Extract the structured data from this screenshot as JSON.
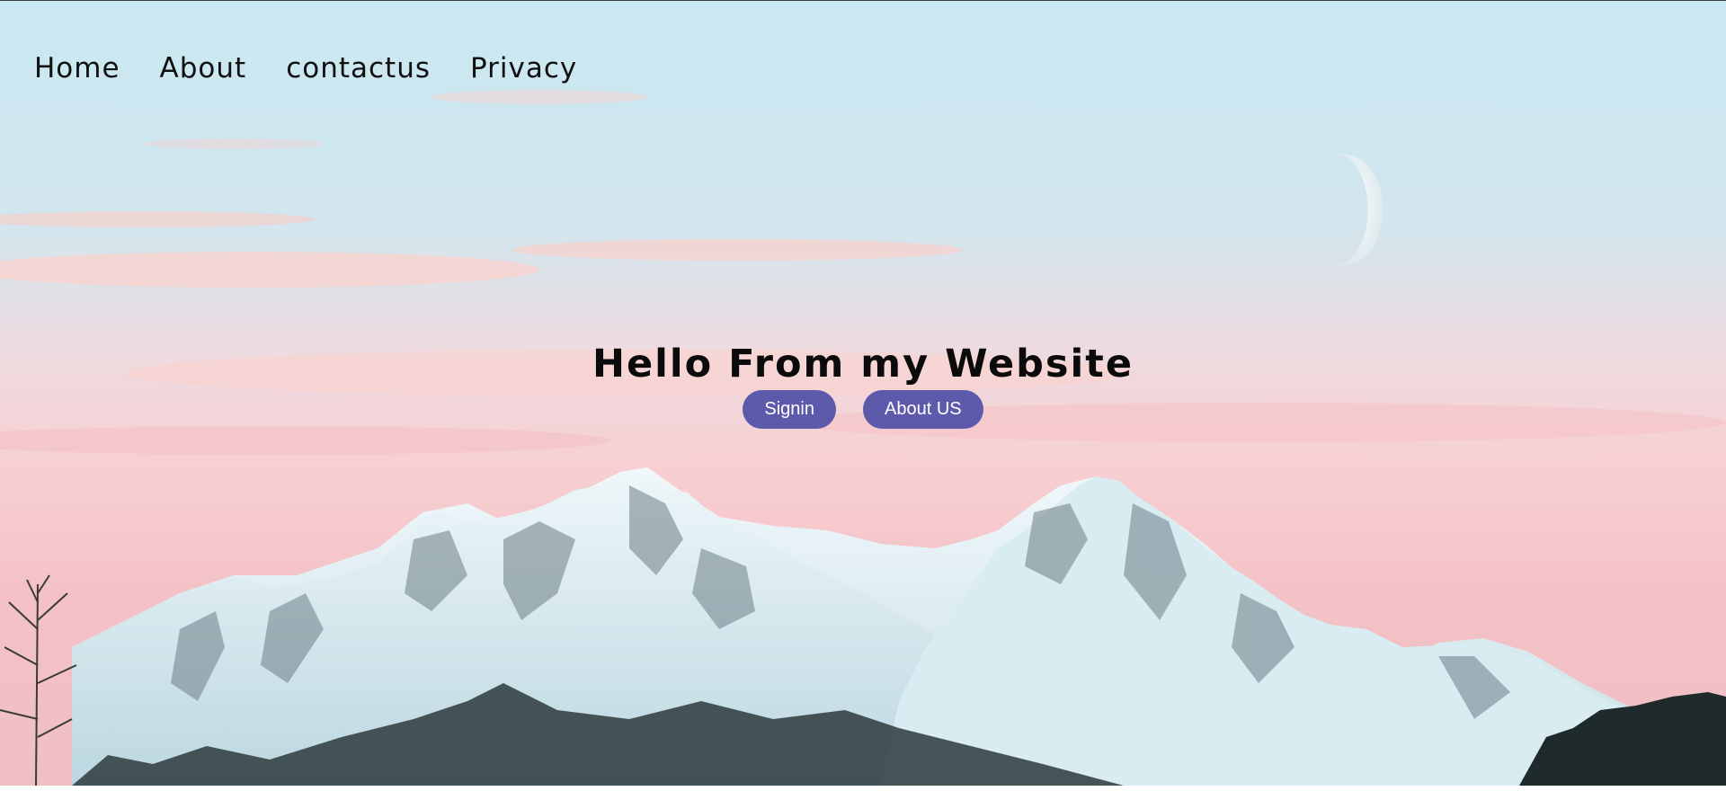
{
  "nav": {
    "items": [
      {
        "label": "Home"
      },
      {
        "label": "About"
      },
      {
        "label": "contactus"
      },
      {
        "label": "Privacy"
      }
    ]
  },
  "hero": {
    "title": "Hello From my Website",
    "buttons": [
      {
        "label": "Signin"
      },
      {
        "label": "About US"
      }
    ]
  },
  "colors": {
    "button_bg": "#5e5aab",
    "sky_top": "#c9e8f1",
    "sky_pink": "#f6c7c8",
    "snow": "#e6f3f7"
  },
  "icons": [
    "moon-icon"
  ]
}
